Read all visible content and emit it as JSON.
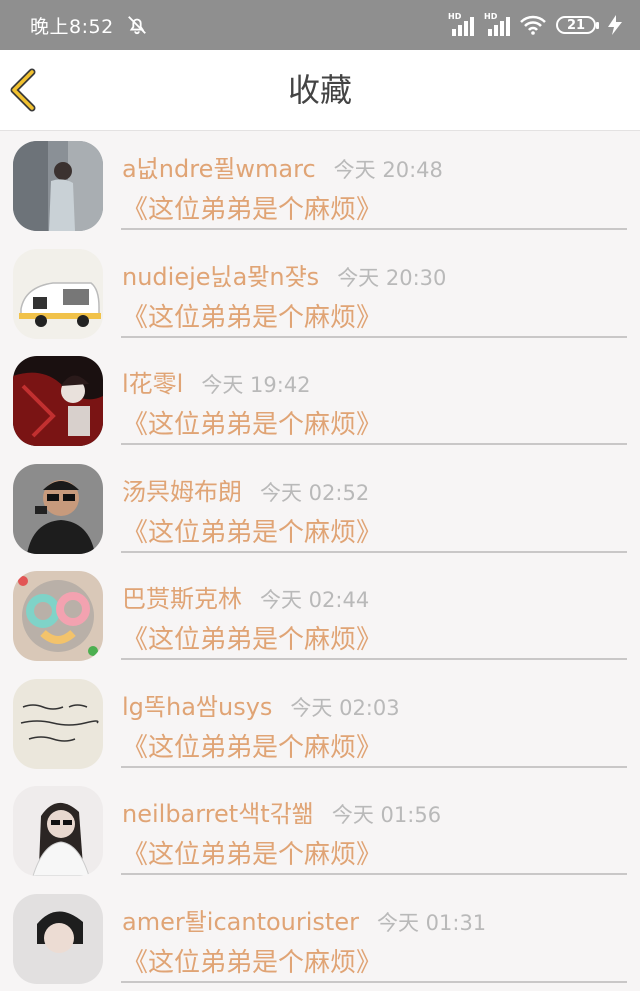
{
  "status_bar": {
    "time": "晚上8:52",
    "hd_1": "HD",
    "hd_2": "HD",
    "battery": "21"
  },
  "header": {
    "title": "收藏"
  },
  "favorites": [
    {
      "name": "a넚ndre퓔wmarc",
      "time": "今天 20:48",
      "book": "《这位弟弟是个麻烦》"
    },
    {
      "name": "nudieje닔a뫚n쟞s",
      "time": "今天 20:30",
      "book": "《这位弟弟是个麻烦》"
    },
    {
      "name": "l花零l",
      "time": "今天 19:42",
      "book": "《这位弟弟是个麻烦》"
    },
    {
      "name": "汤昗姆布朗",
      "time": "今天 02:52",
      "book": "《这位弟弟是个麻烦》"
    },
    {
      "name": "巴贳斯克林",
      "time": "今天 02:44",
      "book": "《这位弟弟是个麻烦》"
    },
    {
      "name": "lg똑ha쌈usys",
      "time": "今天 02:03",
      "book": "《这位弟弟是个麻烦》"
    },
    {
      "name": "neilbarret색t갂쐚",
      "time": "今天 01:56",
      "book": "《这位弟弟是个麻烦》"
    },
    {
      "name": "amer퇄icantourister",
      "time": "今天 01:31",
      "book": "《这位弟弟是个麻烦》"
    }
  ]
}
